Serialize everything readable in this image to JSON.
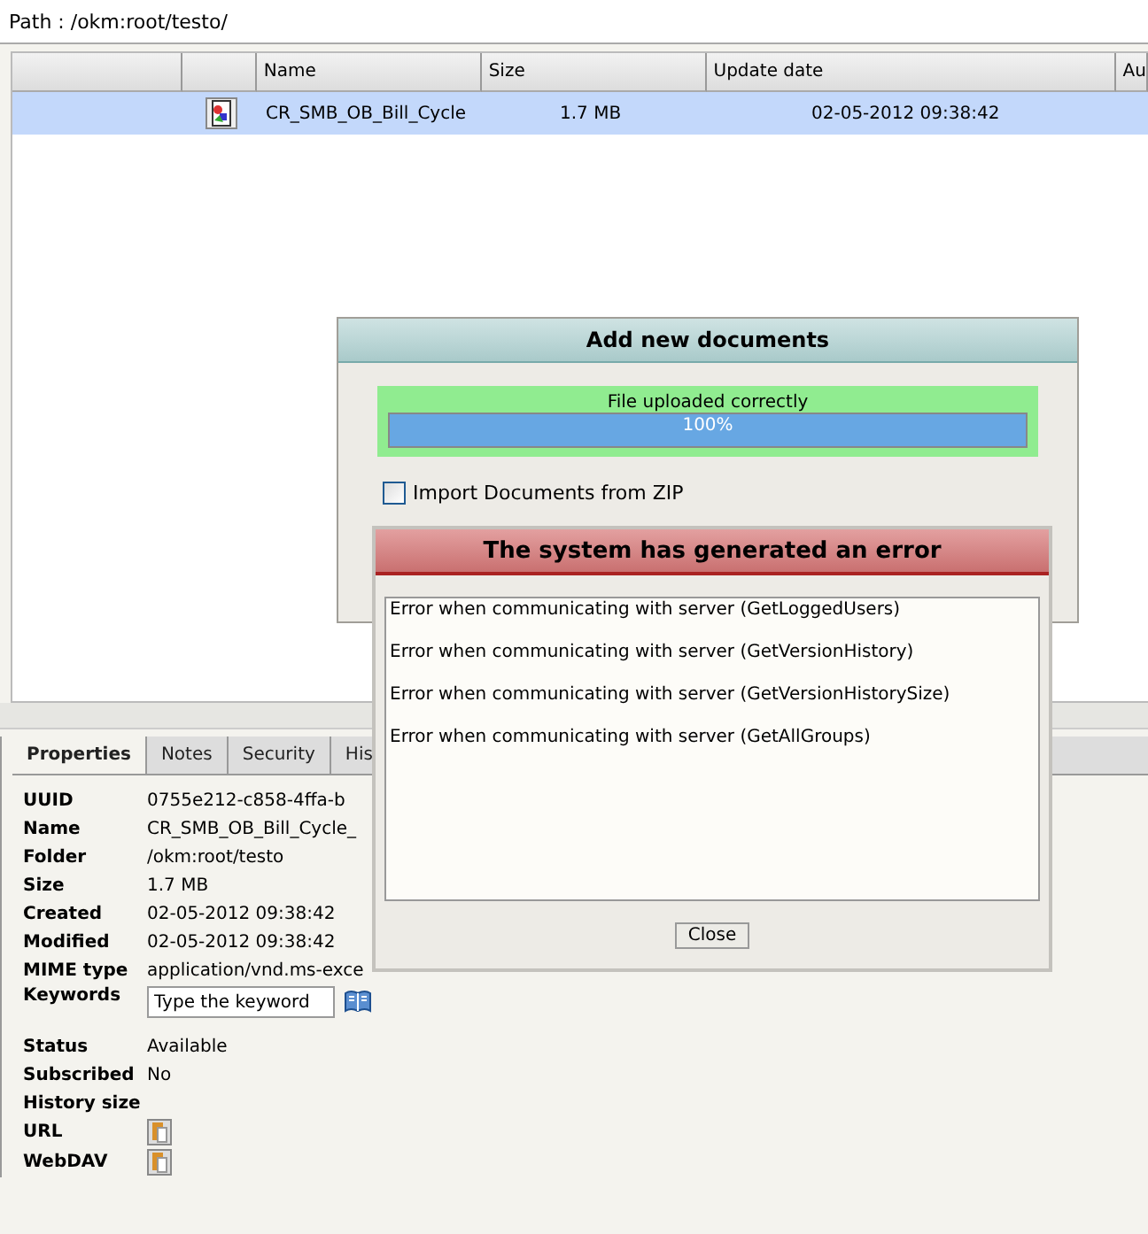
{
  "path_bar": {
    "label": "Path : /okm:root/testo/"
  },
  "table": {
    "columns": [
      "",
      "",
      "Name",
      "Size",
      "Update date",
      "Au"
    ],
    "rows": [
      {
        "name": "CR_SMB_OB_Bill_Cycle",
        "size": "1.7 MB",
        "update_date": "02-05-2012 09:38:42",
        "selected": true
      }
    ]
  },
  "tabs": [
    {
      "label": "Properties",
      "selected": true
    },
    {
      "label": "Notes",
      "selected": false
    },
    {
      "label": "Security",
      "selected": false
    },
    {
      "label": "His",
      "selected": false
    }
  ],
  "properties": [
    {
      "label": "UUID",
      "value": "0755e212-c858-4ffa-b",
      "kind": "text"
    },
    {
      "label": "Name",
      "value": "CR_SMB_OB_Bill_Cycle_",
      "kind": "text"
    },
    {
      "label": "Folder",
      "value": "/okm:root/testo",
      "kind": "text"
    },
    {
      "label": "Size",
      "value": "1.7 MB",
      "kind": "text"
    },
    {
      "label": "Created",
      "value": "02-05-2012 09:38:42",
      "kind": "text"
    },
    {
      "label": "Modified",
      "value": "02-05-2012 09:38:42",
      "kind": "text"
    },
    {
      "label": "MIME type",
      "value": "application/vnd.ms-exce",
      "kind": "text"
    },
    {
      "label": "Keywords",
      "placeholder": "Type the keyword",
      "kind": "keywords"
    },
    {
      "label": "Status",
      "value": "Available",
      "kind": "text"
    },
    {
      "label": "Subscribed",
      "value": "No",
      "kind": "text"
    },
    {
      "label": "History size",
      "kind": "text"
    },
    {
      "label": "URL",
      "kind": "copy"
    },
    {
      "label": "WebDAV",
      "kind": "copy"
    }
  ],
  "upload_dialog": {
    "title": "Add new documents",
    "status": "File uploaded correctly",
    "progress_label": "100%",
    "level": 1,
    "options": [
      {
        "label": "Import Documents from ZIP",
        "checked": false
      }
    ]
  },
  "error_dialog": {
    "title": "The system has generated an error",
    "messages": [
      "Error when communicating with server (GetLoggedUsers)",
      "Error when communicating with server (GetVersionHistory)",
      "Error when communicating with server (GetVersionHistorySize)",
      "Error when communicating with server (GetAllGroups)"
    ],
    "button": "Close"
  }
}
